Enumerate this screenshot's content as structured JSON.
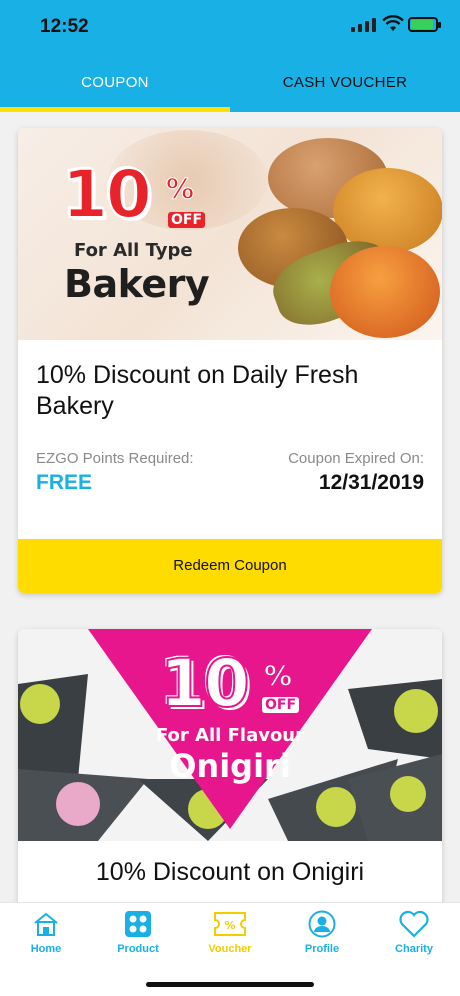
{
  "status_bar": {
    "time": "12:52"
  },
  "tabs": [
    {
      "label": "COUPON",
      "active": true
    },
    {
      "label": "CASH VOUCHER",
      "active": false
    }
  ],
  "coupons": [
    {
      "banner": {
        "percent": "10",
        "percent_sign": "%",
        "off": "OFF",
        "line1": "For All Type",
        "line2": "Bakery"
      },
      "title": "10% Discount on Daily Fresh Bakery",
      "points_label": "EZGO Points Required:",
      "points_value": "FREE",
      "expiry_label": "Coupon Expired On:",
      "expiry_value": "12/31/2019",
      "button_label": "Redeem Coupon"
    },
    {
      "banner": {
        "percent": "10",
        "percent_sign": "%",
        "off": "OFF",
        "line1": "For All Flavour",
        "line2": "Onigiri"
      },
      "title": "10% Discount on Onigiri"
    }
  ],
  "bottom_nav": [
    {
      "label": "Home",
      "icon": "home-icon"
    },
    {
      "label": "Product",
      "icon": "product-grid-icon"
    },
    {
      "label": "Voucher",
      "icon": "voucher-icon",
      "active": true
    },
    {
      "label": "Profile",
      "icon": "profile-icon"
    },
    {
      "label": "Charity",
      "icon": "heart-icon"
    }
  ],
  "colors": {
    "primary": "#19b0e6",
    "accent": "#ffdc00",
    "bakery_red": "#e8242a",
    "onigiri_pink": "#e8168c"
  }
}
